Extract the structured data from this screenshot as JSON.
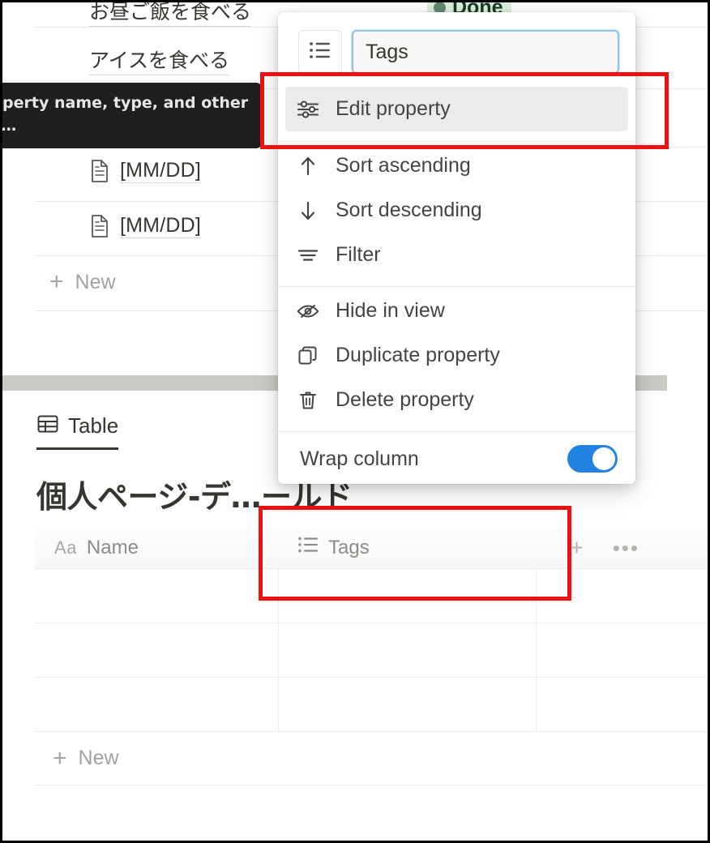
{
  "app": {
    "name": "Notion database view"
  },
  "upper_database": {
    "rows": [
      {
        "label": "お昼ご飯を食べる",
        "icon": "none",
        "status": "Done"
      },
      {
        "label": "アイスを食べる",
        "icon": "none",
        "status": ""
      },
      {
        "label": "[MM/DD]",
        "icon": "page-icon",
        "status": ""
      },
      {
        "label": "[MM/DD]",
        "icon": "page-icon",
        "status": ""
      }
    ],
    "status_badge": {
      "label": "Done",
      "color": "#dbeddb",
      "dot_color": "#5f8a6c"
    },
    "new_row_label": "New"
  },
  "tooltip": {
    "text": "…operty name, type, and other …s…"
  },
  "property_menu": {
    "type_icon": "multi-select-list-icon",
    "name_value": "Tags",
    "items": [
      {
        "id": "edit-property",
        "label": "Edit property",
        "icon": "sliders-icon",
        "highlighted": true
      },
      {
        "id": "sort-ascending",
        "label": "Sort ascending",
        "icon": "arrow-up-icon",
        "highlighted": false
      },
      {
        "id": "sort-descending",
        "label": "Sort descending",
        "icon": "arrow-down-icon",
        "highlighted": false
      },
      {
        "id": "filter",
        "label": "Filter",
        "icon": "filter-icon",
        "highlighted": false
      },
      {
        "id": "hide-in-view",
        "label": "Hide in view",
        "icon": "eye-off-icon",
        "highlighted": false
      },
      {
        "id": "duplicate-property",
        "label": "Duplicate property",
        "icon": "copy-icon",
        "highlighted": false
      },
      {
        "id": "delete-property",
        "label": "Delete property",
        "icon": "trash-icon",
        "highlighted": false
      }
    ],
    "toggle": {
      "label": "Wrap column",
      "state": "on",
      "color": "#2383e2"
    }
  },
  "lower_database": {
    "view_tab": {
      "label": "Table",
      "icon": "table-icon",
      "active": true
    },
    "title": "個人ページ-デ…ールド",
    "columns": [
      {
        "id": "name",
        "label": "Name",
        "icon": "Aa"
      },
      {
        "id": "tags",
        "label": "Tags",
        "icon": "multi-select-list-icon"
      }
    ],
    "header_actions": [
      {
        "id": "add-column",
        "label": "+"
      },
      {
        "id": "more-options",
        "label": "•••"
      }
    ],
    "rows": [
      {
        "name": "",
        "tags": ""
      },
      {
        "name": "",
        "tags": ""
      },
      {
        "name": "",
        "tags": ""
      }
    ],
    "new_row_label": "New"
  },
  "annotations": {
    "boxes": [
      {
        "id": "edit-property-highlight",
        "color": "#ee1111"
      },
      {
        "id": "tags-column-header-highlight",
        "color": "#ee1111"
      }
    ]
  }
}
